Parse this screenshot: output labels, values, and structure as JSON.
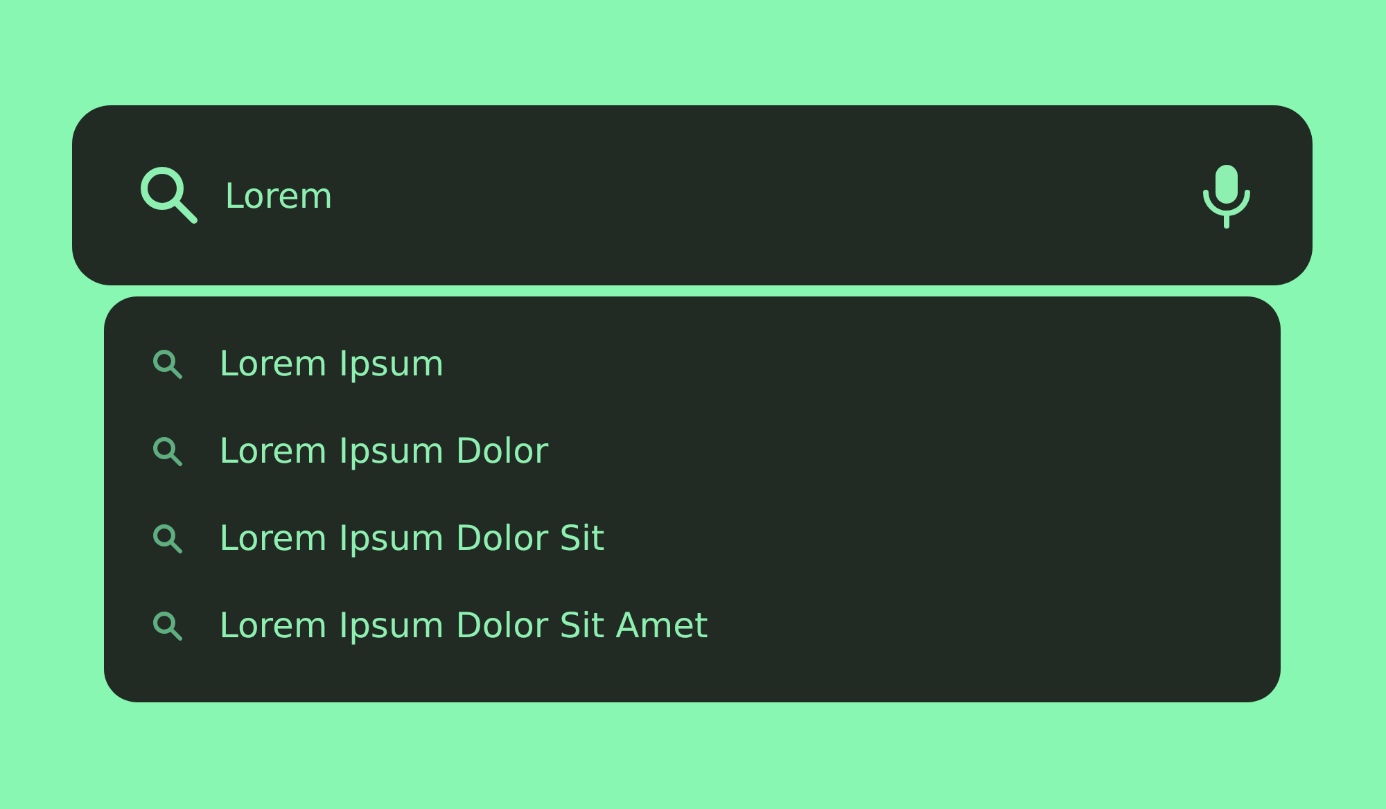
{
  "search": {
    "value": "Lorem"
  },
  "suggestions": [
    {
      "text": "Lorem Ipsum"
    },
    {
      "text": "Lorem Ipsum Dolor"
    },
    {
      "text": "Lorem Ipsum Dolor Sit"
    },
    {
      "text": "Lorem Ipsum Dolor Sit Amet"
    }
  ]
}
